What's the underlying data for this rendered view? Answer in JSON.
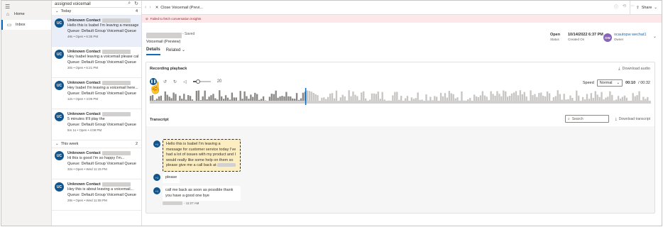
{
  "nav": {
    "items": [
      {
        "label": "Home",
        "icon": "home-icon"
      },
      {
        "label": "Inbox",
        "icon": "inbox-icon"
      }
    ]
  },
  "list": {
    "header": "assigned voicemail",
    "groups": [
      {
        "label": "Today",
        "count": "4"
      },
      {
        "label": "This week",
        "count": "2"
      }
    ],
    "cards_today": [
      {
        "initials": "UC",
        "name": "Unknown Contact",
        "preview": "Hello this is Isabel I'm leaving a message f...",
        "queue": "Queue: Default Group Voicemail Queue",
        "meta": "48s • Open • 6:35 PM"
      },
      {
        "initials": "UC",
        "name": "Unknown Contact",
        "preview": "Hey Isabel leaving a voicemail please call...",
        "queue": "Queue: Default Group Voicemail Queue",
        "meta": "30s • Open • 5:21 PM"
      },
      {
        "initials": "UC",
        "name": "Unknown Contact",
        "preview": "Hey Isabel I'm leaving a voicemail here...",
        "queue": "Queue: Default Group Voicemail Queue",
        "meta": "12s • Open • 4:09 PM"
      },
      {
        "initials": "UC",
        "name": "Unknown Contact",
        "preview": "5 minutes It'll play the",
        "queue": "Queue: Default Group Voicemail Queue",
        "meta": "5m 1s • Open • 4:08 PM"
      }
    ],
    "cards_week": [
      {
        "initials": "UC",
        "name": "Unknown Contact",
        "preview": "Hi this is good I'm so happy I'm...",
        "queue": "Queue: Default Group Voicemail Queue",
        "meta": "32s • Open • Wed 11:15 PM"
      },
      {
        "initials": "UC",
        "name": "Unknown Contact",
        "preview": "Hey this is about leaving a voicemail...",
        "queue": "Queue: Default Group Voicemail Queue",
        "meta": "28s • Open • Wed 11:08 PM"
      }
    ]
  },
  "main": {
    "close_label": "Close Voicemail (Previ...",
    "share_label": "Share",
    "banner": "Failed to fetch conversation insights",
    "saved": "- Saved",
    "record_type": "Voicemail (Preview)",
    "status_value": "Open",
    "status_label": "Status",
    "created_value": "10/14/2022 6:37 PM",
    "created_label": "Created On",
    "owner_initials": "OW",
    "owner_value": "ocautopw wechat1",
    "owner_label": "Owner",
    "tabs": [
      "Details",
      "Related"
    ],
    "recording_title": "Recording playback",
    "download_audio": "Download audio",
    "volume_value": "20",
    "volume_fraction": 0.3,
    "playhead_fraction": 0.31,
    "speed_label": "Speed",
    "speed_value": "Normal",
    "time_current": "00:10",
    "time_total": "/ 00:32",
    "transcript_title": "Transcript",
    "search_placeholder": "Search",
    "download_transcript": "Download transcript",
    "messages": [
      {
        "speaker": "+1",
        "text": "Hello this is Isabel I'm leaving a message for customer service today I've had a lot of issues with my product and I would really like some help on them so please give me a call back at"
      },
      {
        "speaker": "+1",
        "text": "please"
      },
      {
        "speaker": "+1",
        "text": "call me back as soon as possible thank you have a good one bye"
      }
    ],
    "last_time": "- 11:27 AM"
  },
  "colors": {
    "accent": "#0f548c",
    "highlight": "#fdeec2",
    "banner": "#fde7e9"
  }
}
